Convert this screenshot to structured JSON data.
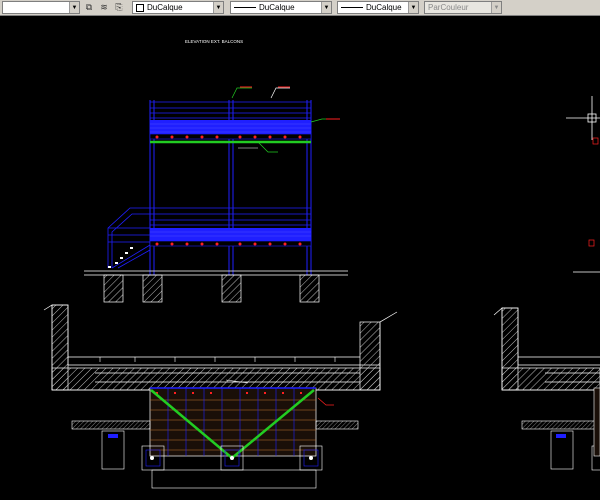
{
  "toolbar": {
    "layer_dropdown_value": "",
    "color_dropdown_value": "DuCalque",
    "linetype_dropdown_value": "DuCalque",
    "lineweight_dropdown_value": "DuCalque",
    "plotstyle_dropdown_value": "ParCouleur",
    "icons": [
      "layer-make-current-icon",
      "layer-previous-icon",
      "layer-states-icon"
    ]
  },
  "drawing": {
    "title": "ELEVATION EXT. BALCONS"
  },
  "colors": {
    "background": "#000000",
    "blue": "#1f1fff",
    "green": "#22cc22",
    "red": "#ff2020",
    "white": "#ffffff",
    "hatch": "#c8c8c8",
    "orange": "#c07830"
  }
}
